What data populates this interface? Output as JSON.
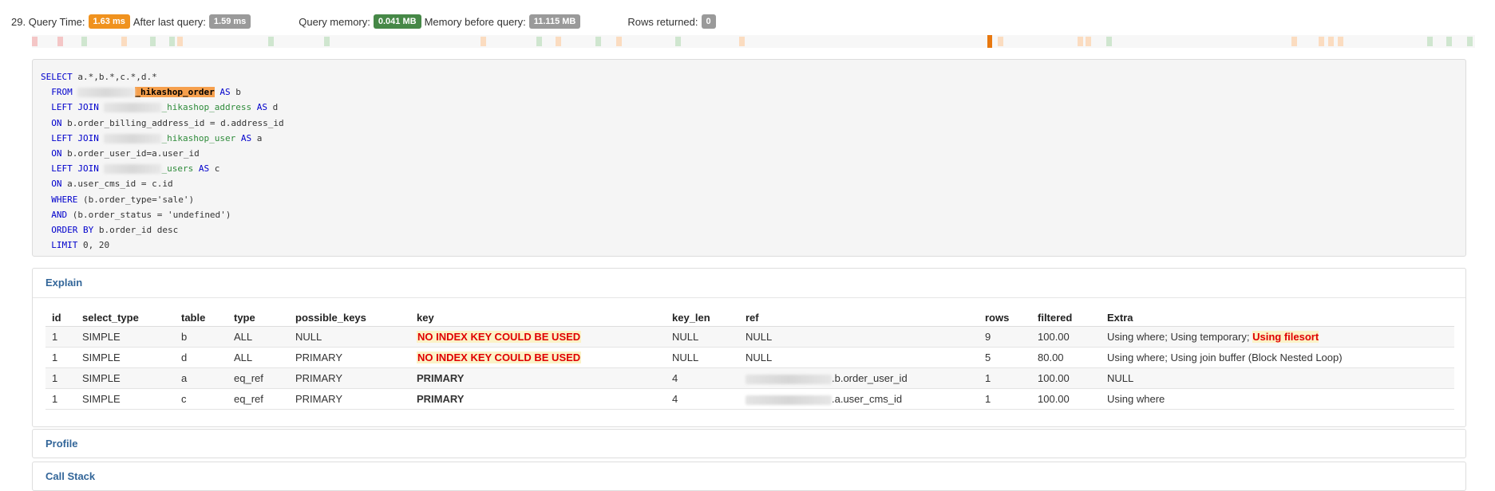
{
  "query": {
    "index": "29.",
    "query_time_label": "Query Time:",
    "query_time": "1.63 ms",
    "after_last_label": "After last query:",
    "after_last": "1.59 ms",
    "memory_label": "Query memory:",
    "memory": "0.041 MB",
    "memory_before_label": "Memory before query:",
    "memory_before": "11.115 MB",
    "rows_label": "Rows returned:",
    "rows": "0"
  },
  "sql": {
    "l1_kw": "SELECT",
    "l1_rest": "a.*,b.*,c.*,d.*",
    "l2_kw": "FROM",
    "l2_table": "_hikashop_order",
    "l2_as": "AS",
    "l2_alias": "b",
    "l3_kw": "LEFT JOIN",
    "l3_table": "_hikashop_address",
    "l3_as": "AS",
    "l3_alias": "d",
    "l4_kw": "ON",
    "l4_rest": "b.order_billing_address_id = d.address_id",
    "l5_kw": "LEFT JOIN",
    "l5_table": "_hikashop_user",
    "l5_as": "AS",
    "l5_alias": "a",
    "l6_kw": "ON",
    "l6_rest": "b.order_user_id=a.user_id",
    "l7_kw": "LEFT JOIN",
    "l7_table": "_users",
    "l7_as": "AS",
    "l7_alias": "c",
    "l8_kw": "ON",
    "l8_rest": "a.user_cms_id = c.id",
    "l9_kw": "WHERE",
    "l9_rest": "(b.order_type='sale')",
    "l10_kw": "AND",
    "l10_rest": "(b.order_status = 'undefined')",
    "l11_kw": "ORDER BY",
    "l11_rest": "b.order_id desc",
    "l12_kw": "LIMIT",
    "l12_rest": "0, 20"
  },
  "explain": {
    "title": "Explain",
    "headers": [
      "id",
      "select_type",
      "table",
      "type",
      "possible_keys",
      "key",
      "key_len",
      "ref",
      "rows",
      "filtered",
      "Extra"
    ],
    "rows": [
      {
        "id": "1",
        "select_type": "SIMPLE",
        "table": "b",
        "type": "ALL",
        "possible_keys": "NULL",
        "key": "NO INDEX KEY COULD BE USED",
        "key_len": "NULL",
        "ref": "NULL",
        "rows": "9",
        "filtered": "100.00",
        "extra": "Using where; Using temporary;",
        "extra_warn": "Using filesort"
      },
      {
        "id": "1",
        "select_type": "SIMPLE",
        "table": "d",
        "type": "ALL",
        "possible_keys": "PRIMARY",
        "key": "NO INDEX KEY COULD BE USED",
        "key_len": "NULL",
        "ref": "NULL",
        "rows": "5",
        "filtered": "80.00",
        "extra": "Using where; Using join buffer (Block Nested Loop)"
      },
      {
        "id": "1",
        "select_type": "SIMPLE",
        "table": "a",
        "type": "eq_ref",
        "possible_keys": "PRIMARY",
        "key": "PRIMARY",
        "key_len": "4",
        "ref": ".b.order_user_id",
        "rows": "1",
        "filtered": "100.00",
        "extra": "NULL"
      },
      {
        "id": "1",
        "select_type": "SIMPLE",
        "table": "c",
        "type": "eq_ref",
        "possible_keys": "PRIMARY",
        "key": "PRIMARY",
        "key_len": "4",
        "ref": ".a.user_cms_id",
        "rows": "1",
        "filtered": "100.00",
        "extra": "Using where"
      }
    ]
  },
  "profile": {
    "title": "Profile"
  },
  "call_stack": {
    "title": "Call Stack"
  },
  "colors": {
    "badge_time": "#f0921e",
    "badge_grey": "#9a9a9a",
    "badge_memory": "#468847",
    "link": "#336699",
    "warning": "#e00000",
    "highlight": "#f6a04d"
  }
}
